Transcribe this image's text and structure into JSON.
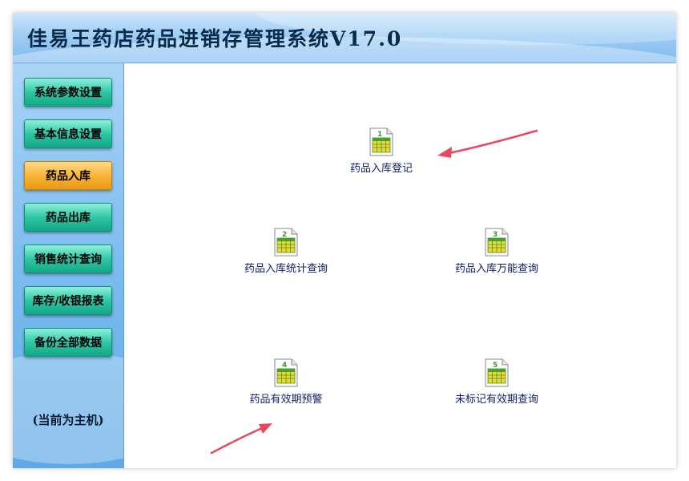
{
  "app": {
    "title": "佳易王药店药品进销存管理系统V17.0"
  },
  "sidebar": {
    "items": [
      {
        "label": "系统参数设置",
        "active": false
      },
      {
        "label": "基本信息设置",
        "active": false
      },
      {
        "label": "药品入库",
        "active": true
      },
      {
        "label": "药品出库",
        "active": false
      },
      {
        "label": "销售统计查询",
        "active": false
      },
      {
        "label": "库存/收银报表",
        "active": false
      },
      {
        "label": "备份全部数据",
        "active": false
      }
    ],
    "host_status": "(当前为主机)"
  },
  "main": {
    "tiles": [
      {
        "number": "1",
        "label": "药品入库登记"
      },
      {
        "number": "2",
        "label": "药品入库统计查询"
      },
      {
        "number": "3",
        "label": "药品入库万能查询"
      },
      {
        "number": "4",
        "label": "药品有效期预警"
      },
      {
        "number": "5",
        "label": "未标记有效期查询"
      }
    ]
  },
  "colors": {
    "nav_button": "#2fc6a6",
    "nav_button_active": "#f7b233",
    "arrow": "#e8485c",
    "tile_label": "#111c6a"
  },
  "icons": {
    "tile": "spreadsheet-document-icon",
    "annotation": "arrow-icon"
  }
}
